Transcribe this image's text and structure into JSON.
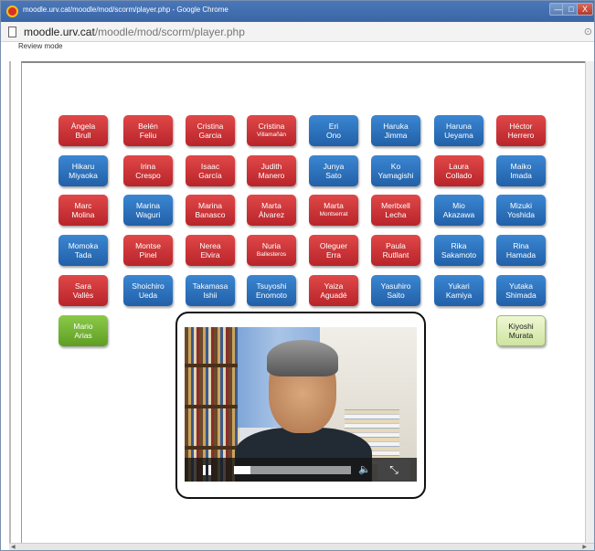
{
  "window": {
    "title": "moodle.urv.cat/moodle/mod/scorm/player.php - Google Chrome",
    "controls": {
      "minimize": "—",
      "maximize": "□",
      "close": "X"
    }
  },
  "address": {
    "domain": "moodle.urv.cat",
    "path": "/moodle/mod/scorm/player.php",
    "extra": "⊙"
  },
  "review_mode": "Review mode",
  "students": [
    {
      "first": "Àngela",
      "last": "Brull",
      "color": "red"
    },
    {
      "first": "Belén",
      "last": "Feliu",
      "color": "red"
    },
    {
      "first": "Cristina",
      "last": "Garcia",
      "color": "red"
    },
    {
      "first": "Cristina",
      "last": "Villamañán",
      "color": "red",
      "small": true
    },
    {
      "first": "Eri",
      "last": "Ono",
      "color": "blue"
    },
    {
      "first": "Haruka",
      "last": "Jimma",
      "color": "blue"
    },
    {
      "first": "Haruna",
      "last": "Ueyama",
      "color": "blue"
    },
    {
      "first": "Héctor",
      "last": "Herrero",
      "color": "red"
    },
    {
      "first": "Hikaru",
      "last": "Miyaoka",
      "color": "blue"
    },
    {
      "first": "Irina",
      "last": "Crespo",
      "color": "red"
    },
    {
      "first": "Isaac",
      "last": "García",
      "color": "red"
    },
    {
      "first": "Judith",
      "last": "Manero",
      "color": "red"
    },
    {
      "first": "Junya",
      "last": "Sato",
      "color": "blue"
    },
    {
      "first": "Ko",
      "last": "Yamagishi",
      "color": "blue"
    },
    {
      "first": "Laura",
      "last": "Collado",
      "color": "red"
    },
    {
      "first": "Maiko",
      "last": "Imada",
      "color": "blue"
    },
    {
      "first": "Marc",
      "last": "Molina",
      "color": "red"
    },
    {
      "first": "Marina",
      "last": "Waguri",
      "color": "blue"
    },
    {
      "first": "Marina",
      "last": "Banasco",
      "color": "red"
    },
    {
      "first": "Marta",
      "last": "Álvarez",
      "color": "red"
    },
    {
      "first": "Marta",
      "last": "Montserrat",
      "color": "red",
      "small": true
    },
    {
      "first": "Meritxell",
      "last": "Lecha",
      "color": "red"
    },
    {
      "first": "Mio",
      "last": "Akazawa",
      "color": "blue"
    },
    {
      "first": "Mizuki",
      "last": "Yoshida",
      "color": "blue"
    },
    {
      "first": "Momoka",
      "last": "Tada",
      "color": "blue"
    },
    {
      "first": "Montse",
      "last": "Pinel",
      "color": "red"
    },
    {
      "first": "Nerea",
      "last": "Elvira",
      "color": "red"
    },
    {
      "first": "Nuria",
      "last": "Ballesteros",
      "color": "red",
      "small": true
    },
    {
      "first": "Oleguer",
      "last": "Erra",
      "color": "red"
    },
    {
      "first": "Paula",
      "last": "Rutllant",
      "color": "red"
    },
    {
      "first": "Rika",
      "last": "Sakamoto",
      "color": "blue"
    },
    {
      "first": "Rina",
      "last": "Hamada",
      "color": "blue"
    },
    {
      "first": "Sara",
      "last": "Vallès",
      "color": "red"
    },
    {
      "first": "Shoichiro",
      "last": "Ueda",
      "color": "blue"
    },
    {
      "first": "Takamasa",
      "last": "Ishii",
      "color": "blue"
    },
    {
      "first": "Tsuyoshi",
      "last": "Enomoto",
      "color": "blue"
    },
    {
      "first": "Yaiza",
      "last": "Aguadé",
      "color": "red"
    },
    {
      "first": "Yasuhiro",
      "last": "Saito",
      "color": "blue"
    },
    {
      "first": "Yukari",
      "last": "Kamiya",
      "color": "blue"
    },
    {
      "first": "Yutaka",
      "last": "Shimada",
      "color": "blue"
    }
  ],
  "extra_left": {
    "first": "Mario",
    "last": "Arias",
    "color": "green"
  },
  "extra_right": {
    "first": "Kiyoshi",
    "last": "Murata",
    "color": "lightgreen"
  },
  "video": {
    "progress_fraction": 0.14,
    "play_icon": "pause-icon",
    "volume_icon": "🔈",
    "fullscreen_icon": "⤡"
  },
  "colors": {
    "red": "#c8302f",
    "blue": "#2e72bd",
    "green": "#76b536",
    "lightgreen": "#dcedb4"
  }
}
